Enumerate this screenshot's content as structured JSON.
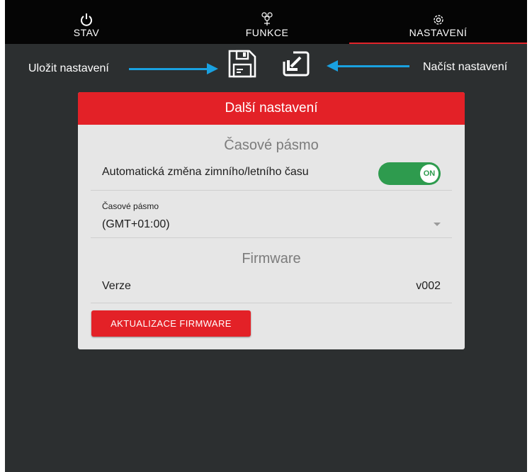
{
  "nav": {
    "tabs": [
      {
        "label": "STAV",
        "icon": "power-icon"
      },
      {
        "label": "FUNKCE",
        "icon": "functions-icon"
      },
      {
        "label": "NASTAVENÍ",
        "icon": "gear-icon"
      }
    ],
    "active_tab": "NASTAVENÍ"
  },
  "annotations": {
    "save_label": "Uložit nastavení",
    "load_label": "Načíst nastavení"
  },
  "toolbar": {
    "save_icon": "floppy-disk-icon",
    "load_icon": "import-icon"
  },
  "card": {
    "title": "Další nastavení",
    "timezone_section": {
      "title": "Časové pásmo",
      "auto_dst_label": "Automatická změna zimního/letního času",
      "auto_dst_toggle": "ON",
      "select_label": "Časové pásmo",
      "select_value": "(GMT+01:00)"
    },
    "firmware_section": {
      "title": "Firmware",
      "version_label": "Verze",
      "version_value": "v002",
      "update_button": "AKTUALIZACE FIRMWARE"
    }
  },
  "colors": {
    "accent_red": "#e32127",
    "toggle_green": "#2e9b4e",
    "annotation_blue": "#19a1e0",
    "background_dark": "#2c2f30"
  }
}
